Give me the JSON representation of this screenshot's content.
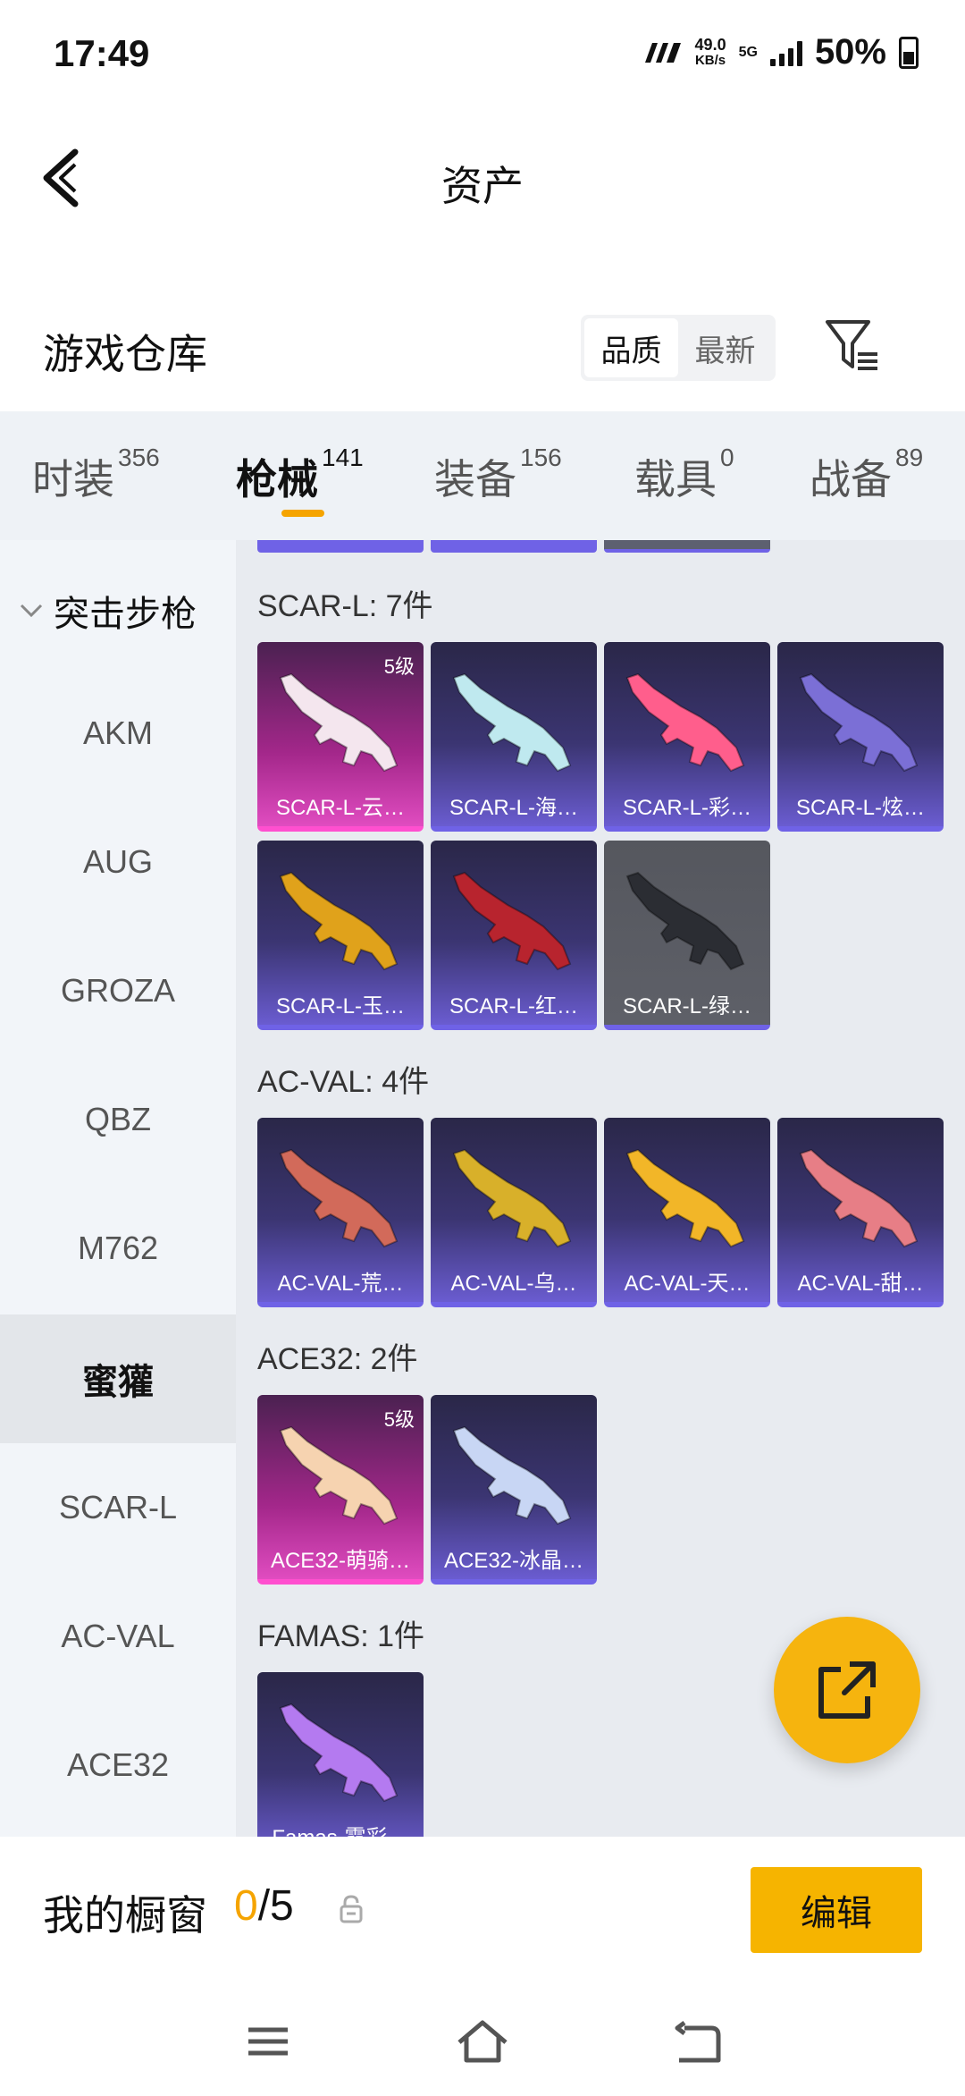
{
  "status_bar": {
    "time": "17:49",
    "net_speed_value": "49.0",
    "net_speed_unit": "KB/s",
    "network": "5G",
    "battery": "50%"
  },
  "header": {
    "title": "资产",
    "back_icon": "back-arrow-icon"
  },
  "warehouse": {
    "title": "游戏仓库",
    "sort_options": [
      "品质",
      "最新"
    ],
    "sort_selected": "品质",
    "filter_icon": "filter-icon"
  },
  "category_tabs": [
    {
      "label": "时装",
      "count": "356"
    },
    {
      "label": "枪械",
      "count": "141",
      "active": true
    },
    {
      "label": "装备",
      "count": "156"
    },
    {
      "label": "载具",
      "count": "0"
    },
    {
      "label": "战备",
      "count": "89"
    }
  ],
  "sidebar": {
    "group": "突击步枪",
    "items": [
      "AKM",
      "AUG",
      "GROZA",
      "QBZ",
      "M762",
      "蜜獾",
      "SCAR-L",
      "AC-VAL",
      "ACE32"
    ],
    "selected": "蜜獾"
  },
  "groups": [
    {
      "label": "SCAR-L: 7件",
      "items": [
        {
          "name": "SCAR-L-云…",
          "level": "5级",
          "rarity": "pink",
          "color": "#f4e6ee"
        },
        {
          "name": "SCAR-L-海…",
          "rarity": "purple",
          "color": "#bfe9ef"
        },
        {
          "name": "SCAR-L-彩…",
          "rarity": "purple",
          "color": "#ff5e8c"
        },
        {
          "name": "SCAR-L-炫…",
          "rarity": "purple",
          "color": "#7b6fd6"
        },
        {
          "name": "SCAR-L-玉…",
          "rarity": "purple",
          "color": "#e0a21b"
        },
        {
          "name": "SCAR-L-红…",
          "rarity": "purple",
          "color": "#b8242e"
        },
        {
          "name": "SCAR-L-绿…",
          "rarity": "grey",
          "color": "#2b2d33"
        }
      ]
    },
    {
      "label": "AC-VAL: 4件",
      "items": [
        {
          "name": "AC-VAL-荒…",
          "rarity": "purple",
          "color": "#d26a5a"
        },
        {
          "name": "AC-VAL-乌…",
          "rarity": "purple",
          "color": "#d8b02a"
        },
        {
          "name": "AC-VAL-天…",
          "rarity": "purple",
          "color": "#f2b628"
        },
        {
          "name": "AC-VAL-甜…",
          "rarity": "purple",
          "color": "#e77e86"
        }
      ]
    },
    {
      "label": "ACE32: 2件",
      "items": [
        {
          "name": "ACE32-萌骑…",
          "level": "5级",
          "rarity": "pink",
          "color": "#f6d3b0"
        },
        {
          "name": "ACE32-冰晶…",
          "rarity": "purple",
          "color": "#c8d6f4"
        }
      ]
    },
    {
      "label": "FAMAS: 1件",
      "items": [
        {
          "name": "Famas-霓彩…",
          "rarity": "purple",
          "color": "#b47af0"
        }
      ]
    }
  ],
  "showcase": {
    "label": "我的橱窗",
    "current": "0",
    "total": "/5",
    "edit_label": "编辑"
  },
  "colors": {
    "accent": "#f5a400",
    "pink_rarity": "#ff4fcf",
    "purple_rarity": "#6f62e6"
  }
}
